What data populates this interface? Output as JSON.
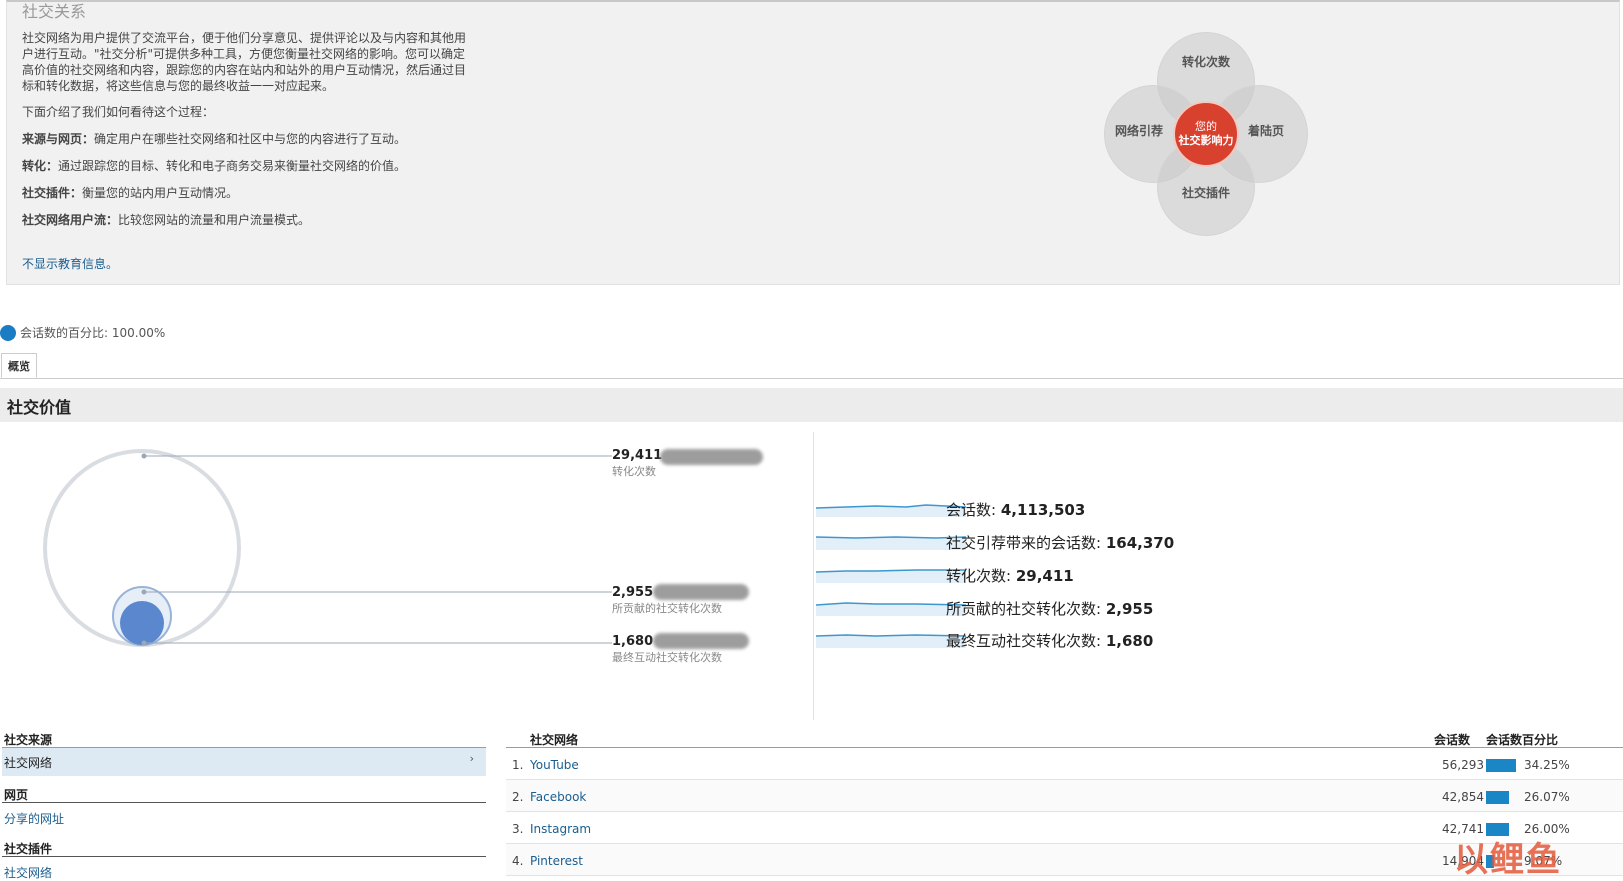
{
  "intro": {
    "title": "社交关系",
    "paragraph": "社交网络为用户提供了交流平台，便于他们分享意见、提供评论以及与内容和其他用户进行互动。\"社交分析\"可提供多种工具，方便您衡量社交网络的影响。您可以确定高价值的社交网络和内容，跟踪您的内容在站内和站外的用户互动情况，然后通过目标和转化数据，将这些信息与您的最终收益一一对应起来。",
    "process_intro": "下面介绍了我们如何看待这个过程：",
    "items": [
      {
        "label": "来源与网页：",
        "text": "确定用户在哪些社交网络和社区中与您的内容进行了互动。"
      },
      {
        "label": "转化：",
        "text": "通过跟踪您的目标、转化和电子商务交易来衡量社交网络的价值。"
      },
      {
        "label": "社交插件：",
        "text": "衡量您的站内用户互动情况。"
      },
      {
        "label": "社交网络用户流：",
        "text": "比较您网站的流量和用户流量模式。"
      }
    ],
    "hide_link": "不显示教育信息。",
    "diagram": {
      "top": "转化次数",
      "left": "网络引荐",
      "right": "着陆页",
      "bottom": "社交插件",
      "center_line1": "您的",
      "center_line2": "社交影响力"
    }
  },
  "sessions_pct": "会话数的百分比: 100.00%",
  "tabs": [
    "概览"
  ],
  "section_title": "社交价值",
  "conversions": [
    {
      "value": "29,411",
      "label": "转化次数"
    },
    {
      "value": "2,955",
      "label": "所贡献的社交转化次数"
    },
    {
      "value": "1,680",
      "label": "最终互动社交转化次数"
    }
  ],
  "kpis": [
    {
      "label": "会话数:",
      "value": "4,113,503"
    },
    {
      "label": "社交引荐带来的会话数:",
      "value": "164,370"
    },
    {
      "label": "转化次数:",
      "value": "29,411"
    },
    {
      "label": "所贡献的社交转化次数:",
      "value": "2,955"
    },
    {
      "label": "最终互动社交转化次数:",
      "value": "1,680"
    }
  ],
  "left_nav": {
    "source_head": "社交来源",
    "source_item": "社交网络",
    "pages_head": "网页",
    "pages_item": "分享的网址",
    "plugins_head": "社交插件",
    "plugins_item": "社交网络"
  },
  "table": {
    "col_network": "社交网络",
    "col_sessions": "会话数",
    "col_pct": "会话数百分比",
    "rows": [
      {
        "rank": "1.",
        "name": "YouTube",
        "sessions": "56,293",
        "pct": "34.25%",
        "share": 34.25
      },
      {
        "rank": "2.",
        "name": "Facebook",
        "sessions": "42,854",
        "pct": "26.07%",
        "share": 26.07
      },
      {
        "rank": "3.",
        "name": "Instagram",
        "sessions": "42,741",
        "pct": "26.00%",
        "share": 26.0
      },
      {
        "rank": "4.",
        "name": "Pinterest",
        "sessions": "14,904",
        "pct": "9.07%",
        "share": 9.07
      }
    ]
  },
  "watermark": "以鲤鱼",
  "colors": {
    "accent": "#1a86c6",
    "core": "#d9412f",
    "circle": "#5b87cf"
  }
}
